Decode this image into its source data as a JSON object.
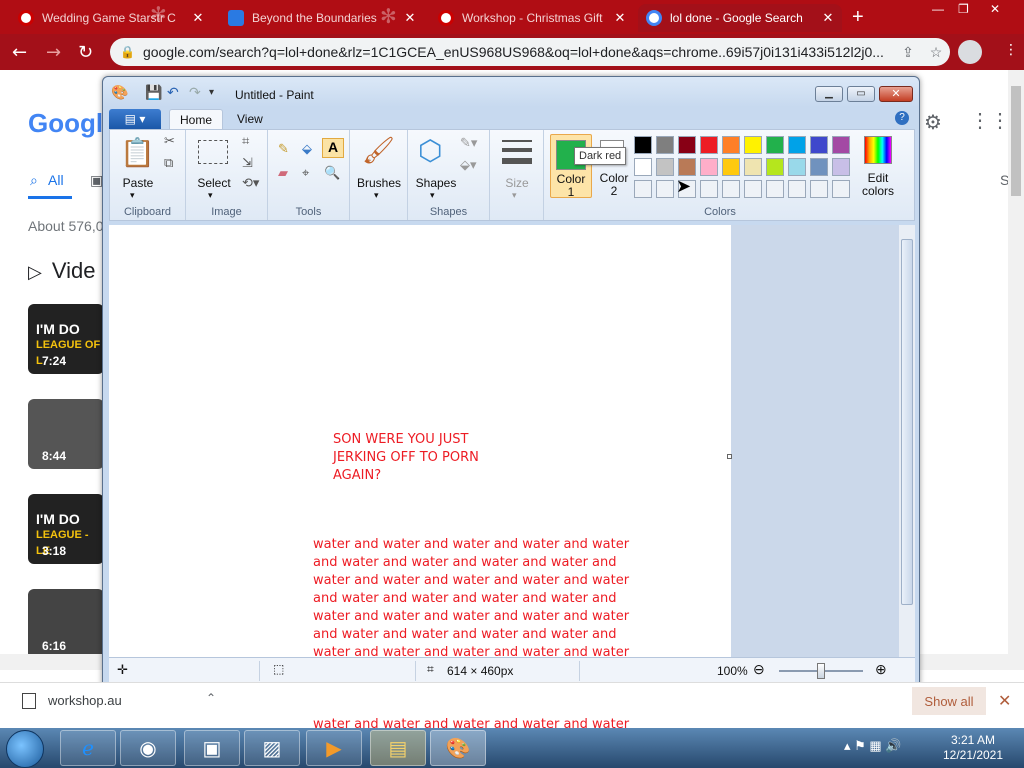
{
  "browser": {
    "tabs": [
      {
        "label": "Wedding Game Starstr C",
        "active": false
      },
      {
        "label": "Beyond the Boundaries",
        "active": false
      },
      {
        "label": "Workshop - Christmas Gift",
        "active": false
      },
      {
        "label": "lol done - Google Search",
        "active": true
      }
    ],
    "address": "google.com/search?q=lol+done&rlz=1C1GCEA_enUS968US968&oq=lol+done&aqs=chrome..69i57j0i131i433i512l2j0..."
  },
  "google": {
    "logo": "Google",
    "tab_all": "All",
    "about": "About 576,0",
    "videos_heading": "Vide",
    "thumbs": [
      {
        "title": "I'M DO",
        "subtitle": "LEAGUE OF L",
        "duration": "7:24"
      },
      {
        "title": "",
        "subtitle": "",
        "duration": "8:44"
      },
      {
        "title": "I'M DO",
        "subtitle": "LEAGUE - LE",
        "duration": "3:18"
      },
      {
        "title": "",
        "subtitle": "",
        "duration": "6:16"
      }
    ],
    "right_label": "S"
  },
  "paint": {
    "title": "Untitled - Paint",
    "file_label": "▤ ▾",
    "tabs": {
      "home": "Home",
      "view": "View"
    },
    "groups": {
      "clipboard": "Clipboard",
      "image": "Image",
      "tools": "Tools",
      "shapes_group": "Shapes",
      "colors": "Colors"
    },
    "buttons": {
      "paste": "Paste",
      "select": "Select",
      "brushes": "Brushes",
      "shapes": "Shapes",
      "size": "Size",
      "color1_line1": "Color",
      "color1_line2": "1",
      "color2_line1": "Color",
      "color2_line2": "2",
      "edit_colors_line1": "Edit",
      "edit_colors_line2": "colors"
    },
    "palette_row1": [
      "#000000",
      "#7f7f7f",
      "#880015",
      "#ed1c24",
      "#ff7f27",
      "#fff200",
      "#22b14c",
      "#00a2e8",
      "#3f48cc",
      "#a349a4"
    ],
    "palette_row2": [
      "#ffffff",
      "#c3c3c3",
      "#b97a57",
      "#ffaec9",
      "#ffc90e",
      "#efe4b0",
      "#b5e61d",
      "#99d9ea",
      "#7092be",
      "#c8bfe7"
    ],
    "color1": "#22b14c",
    "tooltip": "Dark red",
    "canvas_text1": "SON WERE YOU JUST\nJERKING OFF TO PORN\nAGAIN?",
    "canvas_text2": "water and water and water and water and water and water and water and water and water and water and water and water and water and water and water and water and water and water and water and water and water and water and water and water and water and water and water and water and water and water and water and water and water and water and water and water and water and water and water and water and water and water and water and water and water and water and water and water and water and water and water and water and water and water and water and water and water and water and water and water and",
    "status_size": "614 × 460px",
    "zoom": "100%",
    "text_color": "#ed1c24"
  },
  "downloads": {
    "file": "workshop.au",
    "show_all": "Show all"
  },
  "taskbar": {
    "time": "3:21 AM",
    "date": "12/21/2021"
  }
}
